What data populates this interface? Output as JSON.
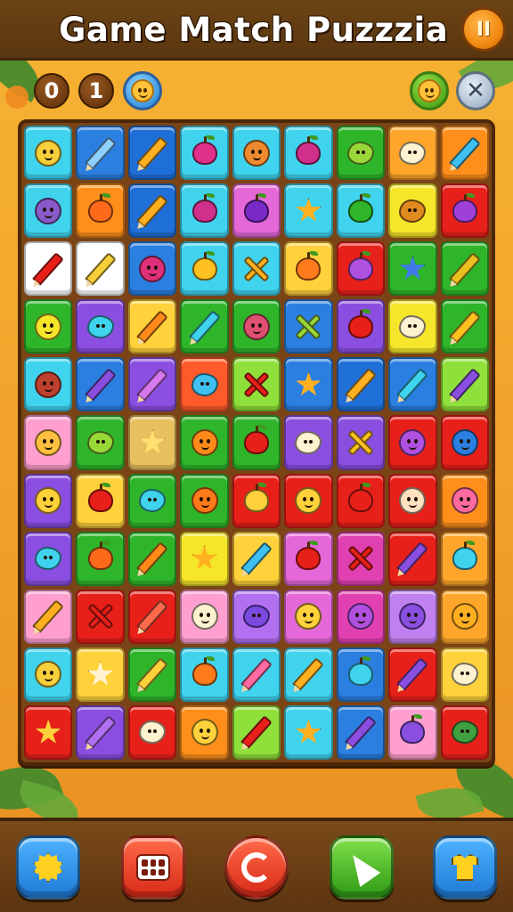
{
  "header": {
    "title": "Game Match Puzzzia",
    "pause_label": "II"
  },
  "status": {
    "score_digits": [
      "0",
      "1"
    ],
    "avatar_icon": "smiley-face-icon",
    "hint_face_icon": "smiley-face-icon",
    "close_icon": "close-icon",
    "close_symbol": "✕"
  },
  "board": {
    "rows": 11,
    "cols": 9,
    "tiles": [
      [
        [
          "#3fd3ee",
          "face",
          "#f6cf3a"
        ],
        [
          "#2a7fe0",
          "pencil",
          "#8fd0ff"
        ],
        [
          "#1f6fd8",
          "pencil",
          "#ffb020"
        ],
        [
          "#3fd3ee",
          "fruit",
          "#e0308a"
        ],
        [
          "#3fd3ee",
          "face",
          "#f08a30"
        ],
        [
          "#3fd3ee",
          "fruit",
          "#d0308a"
        ],
        [
          "#2fb52a",
          "blob",
          "#9ad83a"
        ],
        [
          "#ffa52a",
          "blob",
          "#fff2d0"
        ],
        [
          "#ff8f1a",
          "pencil",
          "#3fc0f0"
        ]
      ],
      [
        [
          "#3fd3ee",
          "face",
          "#8a5ac8"
        ],
        [
          "#ff8f1a",
          "fruit",
          "#ff6a1a"
        ],
        [
          "#1f6fd8",
          "pencil",
          "#ffb020"
        ],
        [
          "#3fd3ee",
          "fruit",
          "#d0308a"
        ],
        [
          "#e468d8",
          "fruit",
          "#7a2ac8"
        ],
        [
          "#3fd3ee",
          "burst",
          "#ffb020"
        ],
        [
          "#3fd3ee",
          "fruit",
          "#2fb52a"
        ],
        [
          "#f6e62a",
          "blob",
          "#e08a20"
        ],
        [
          "#e8201a",
          "fruit",
          "#a040d8"
        ]
      ],
      [
        [
          "#ffffff",
          "pencil",
          "#e8201a"
        ],
        [
          "#ffffff",
          "pencil",
          "#f6cf3a"
        ],
        [
          "#2a7fe0",
          "face",
          "#e0307a"
        ],
        [
          "#3fd3ee",
          "fruit",
          "#ffc020"
        ],
        [
          "#3fd3ee",
          "cross",
          "#ffb020"
        ],
        [
          "#ffd13a",
          "fruit",
          "#ff7a1a"
        ],
        [
          "#e8201a",
          "fruit",
          "#b050e0"
        ],
        [
          "#2fb52a",
          "burst",
          "#3f7ae8"
        ],
        [
          "#2fb52a",
          "pencil",
          "#e8c020"
        ]
      ],
      [
        [
          "#2fb52a",
          "face",
          "#f6e62a"
        ],
        [
          "#8a4fe0",
          "blob",
          "#3fd3ee"
        ],
        [
          "#ffd13a",
          "pencil",
          "#ff8a1a"
        ],
        [
          "#2fb52a",
          "pencil",
          "#3fd3ee"
        ],
        [
          "#2fb52a",
          "face",
          "#e05070"
        ],
        [
          "#2a7fe0",
          "cross",
          "#9ad83a"
        ],
        [
          "#8a4fe0",
          "fruit",
          "#e8201a"
        ],
        [
          "#f6e62a",
          "blob",
          "#fff2d0"
        ],
        [
          "#2fb52a",
          "pencil",
          "#ffc020"
        ]
      ],
      [
        [
          "#3fd3ee",
          "face",
          "#c04030"
        ],
        [
          "#2a7fe0",
          "pencil",
          "#8a4fe0"
        ],
        [
          "#8a4fe0",
          "pencil",
          "#d878f0"
        ],
        [
          "#ff5a2a",
          "blob",
          "#3fc0f0"
        ],
        [
          "#8fe03a",
          "cross",
          "#e8201a"
        ],
        [
          "#2a7fe0",
          "burst",
          "#ffb020"
        ],
        [
          "#1f6fd8",
          "pencil",
          "#ffb020"
        ],
        [
          "#2a7fe0",
          "pencil",
          "#3fd3ee"
        ],
        [
          "#8fe03a",
          "pencil",
          "#8a4fe0"
        ]
      ],
      [
        [
          "#ff9fd0",
          "face",
          "#ffc040"
        ],
        [
          "#2fb52a",
          "blob",
          "#9ad83a"
        ],
        [
          "#e8c060",
          "burst",
          "#ffe070"
        ],
        [
          "#2fb52a",
          "face",
          "#ff8a1a"
        ],
        [
          "#2fb52a",
          "fruit",
          "#e8201a"
        ],
        [
          "#8a4fe0",
          "blob",
          "#fff2d0"
        ],
        [
          "#8a4fe0",
          "cross",
          "#ffc020"
        ],
        [
          "#e8201a",
          "face",
          "#b050e0"
        ],
        [
          "#e8201a",
          "face",
          "#2a7fe0"
        ]
      ],
      [
        [
          "#8a4fe0",
          "face",
          "#ffd13a"
        ],
        [
          "#ffd13a",
          "fruit",
          "#e8201a"
        ],
        [
          "#2fb52a",
          "blob",
          "#3fd3ee"
        ],
        [
          "#2fb52a",
          "face",
          "#ff7a1a"
        ],
        [
          "#e8201a",
          "fruit",
          "#ffd13a"
        ],
        [
          "#e8201a",
          "face",
          "#ffd13a"
        ],
        [
          "#e8201a",
          "fruit",
          "#e8201a"
        ],
        [
          "#e8201a",
          "face",
          "#ffe0c0"
        ],
        [
          "#ff8f1a",
          "face",
          "#ff6aa0"
        ]
      ],
      [
        [
          "#8a4fe0",
          "blob",
          "#3fd3ee"
        ],
        [
          "#2fb52a",
          "fruit",
          "#ff6a1a"
        ],
        [
          "#2fb52a",
          "pencil",
          "#ff8a1a"
        ],
        [
          "#f6e62a",
          "burst",
          "#ffb020"
        ],
        [
          "#ffd13a",
          "pencil",
          "#3fc0f0"
        ],
        [
          "#e468d8",
          "fruit",
          "#e8201a"
        ],
        [
          "#e040b0",
          "cross",
          "#e8201a"
        ],
        [
          "#e8201a",
          "pencil",
          "#8a4fe0"
        ],
        [
          "#ffa52a",
          "fruit",
          "#3fd3ee"
        ]
      ],
      [
        [
          "#ff9fd0",
          "pencil",
          "#ffb020"
        ],
        [
          "#e8201a",
          "cross",
          "#e8201a"
        ],
        [
          "#e8201a",
          "pencil",
          "#ff6a4a"
        ],
        [
          "#ff9fd0",
          "face",
          "#fff2d0"
        ],
        [
          "#b070f0",
          "blob",
          "#7a4ae0"
        ],
        [
          "#e468d8",
          "face",
          "#ffd13a"
        ],
        [
          "#e040b0",
          "face",
          "#b050e0"
        ],
        [
          "#c080f0",
          "face",
          "#8a4fe0"
        ],
        [
          "#ffa52a",
          "face",
          "#ffb020"
        ]
      ],
      [
        [
          "#3fd3ee",
          "face",
          "#f6cf3a"
        ],
        [
          "#ffd13a",
          "burst",
          "#fff2d0"
        ],
        [
          "#2fb52a",
          "pencil",
          "#ffd13a"
        ],
        [
          "#3fd3ee",
          "fruit",
          "#ff7a1a"
        ],
        [
          "#3fd3ee",
          "pencil",
          "#ff6aa0"
        ],
        [
          "#3fd3ee",
          "pencil",
          "#ffb020"
        ],
        [
          "#2a7fe0",
          "fruit",
          "#3fd3ee"
        ],
        [
          "#e8201a",
          "pencil",
          "#8a4fe0"
        ],
        [
          "#ffd13a",
          "blob",
          "#fff2d0"
        ]
      ],
      [
        [
          "#e8201a",
          "burst",
          "#ffd13a"
        ],
        [
          "#8a4fe0",
          "pencil",
          "#b070f0"
        ],
        [
          "#e8201a",
          "blob",
          "#fff2d0"
        ],
        [
          "#ff8f1a",
          "face",
          "#ffd13a"
        ],
        [
          "#8fe03a",
          "pencil",
          "#e8201a"
        ],
        [
          "#3fd3ee",
          "burst",
          "#ffb020"
        ],
        [
          "#2a7fe0",
          "pencil",
          "#8a4fe0"
        ],
        [
          "#ff9fd0",
          "fruit",
          "#8a4fe0"
        ],
        [
          "#e8201a",
          "blob",
          "#3fa040"
        ]
      ]
    ]
  },
  "toolbar": {
    "settings_icon": "gear-icon",
    "grid_icon": "grid-dots-icon",
    "refresh_icon": "refresh-icon",
    "hint_icon": "cursor-arrow-icon",
    "shop_icon": "shirt-icon"
  },
  "colors": {
    "background": "#f1a12a",
    "frame": "#5a3610",
    "accent_orange": "#f28a12"
  }
}
